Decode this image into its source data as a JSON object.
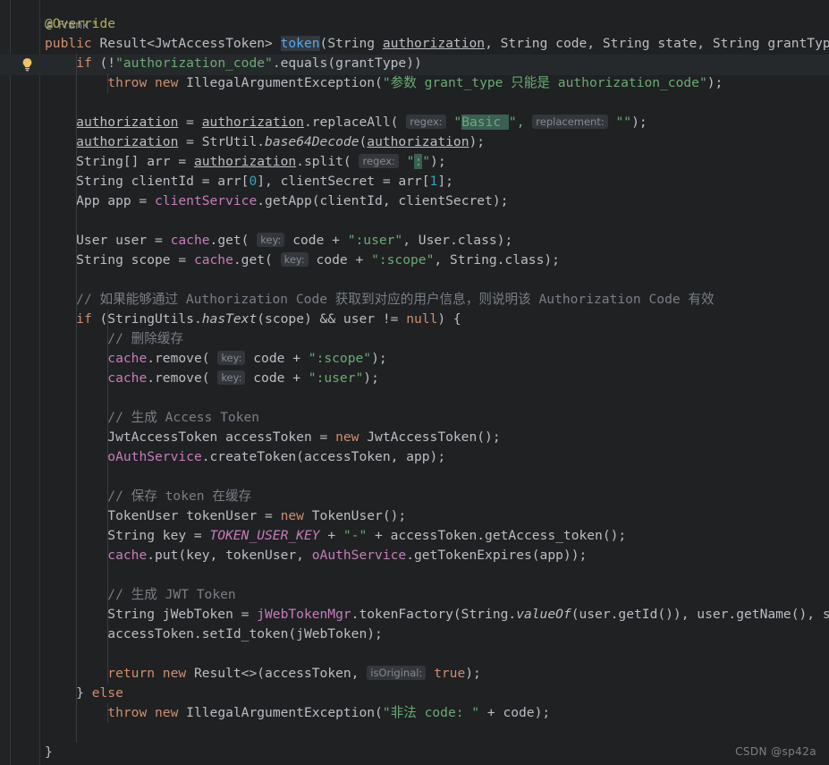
{
  "editor": {
    "theme": "dark",
    "background": "#1f2123",
    "current_line_background": "#26292c",
    "watermark": "CSDN @sp42a"
  },
  "vcs_annotation": {
    "icon": "person-icon",
    "author": "Frank",
    "modified_marker": "*"
  },
  "gutter": {
    "intention_icon": "lightbulb-icon"
  },
  "colors": {
    "keyword": "#cf8e6d",
    "string": "#6aab73",
    "number": "#2aacb8",
    "comment": "#7a7e85",
    "annotation": "#b3ae60",
    "field": "#c77dbb",
    "method_declaration": "#56a8f5",
    "default_text": "#bcbec4",
    "inlay_hint_bg": "#33363b",
    "selection_highlight": "#3a5f53"
  },
  "code": {
    "language": "java",
    "lines": [
      {
        "tokens": [
          {
            "t": "@Override",
            "c": "anno"
          }
        ]
      },
      {
        "tokens": [
          {
            "t": "public ",
            "c": "kw"
          },
          {
            "t": "Result<JwtAccessToken> ",
            "c": "type"
          },
          {
            "t": "token",
            "c": "method-d hl-ident"
          },
          {
            "t": "(String ",
            "c": "ident"
          },
          {
            "t": "authorization",
            "c": "param-u"
          },
          {
            "t": ", String code, String state, String grantType) {",
            "c": "ident"
          }
        ]
      },
      {
        "tokens": [
          {
            "t": "    ",
            "c": "ident"
          },
          {
            "t": "if",
            "c": "kw"
          },
          {
            "t": " (!",
            "c": "ident"
          },
          {
            "t": "\"authorization_code\"",
            "c": "str"
          },
          {
            "t": ".equals(grantType))",
            "c": "ident"
          }
        ]
      },
      {
        "tokens": [
          {
            "t": "        ",
            "c": "ident"
          },
          {
            "t": "throw new ",
            "c": "kw"
          },
          {
            "t": "IllegalArgumentException(",
            "c": "ident"
          },
          {
            "t": "\"参数 grant_type 只能是 authorization_code\"",
            "c": "str"
          },
          {
            "t": ");",
            "c": "ident"
          }
        ]
      },
      {
        "tokens": []
      },
      {
        "tokens": [
          {
            "t": "    ",
            "c": "ident"
          },
          {
            "t": "authorization",
            "c": "param-u"
          },
          {
            "t": " = ",
            "c": "ident"
          },
          {
            "t": "authorization",
            "c": "param-u"
          },
          {
            "t": ".replaceAll( ",
            "c": "ident"
          },
          {
            "t": "regex:",
            "c": "hint"
          },
          {
            "t": " \"",
            "c": "str"
          },
          {
            "t": "Basic ",
            "c": "str hl-sel"
          },
          {
            "t": "\", ",
            "c": "str"
          },
          {
            "t": "replacement:",
            "c": "hint"
          },
          {
            "t": " \"\"",
            "c": "str"
          },
          {
            "t": ");",
            "c": "ident"
          }
        ]
      },
      {
        "tokens": [
          {
            "t": "    ",
            "c": "ident"
          },
          {
            "t": "authorization",
            "c": "param-u"
          },
          {
            "t": " = StrUtil.",
            "c": "ident"
          },
          {
            "t": "base64Decode",
            "c": "static-it"
          },
          {
            "t": "(",
            "c": "ident"
          },
          {
            "t": "authorization",
            "c": "param-u"
          },
          {
            "t": ");",
            "c": "ident"
          }
        ]
      },
      {
        "tokens": [
          {
            "t": "    String[] arr = ",
            "c": "ident"
          },
          {
            "t": "authorization",
            "c": "param-u"
          },
          {
            "t": ".split( ",
            "c": "ident"
          },
          {
            "t": "regex:",
            "c": "hint"
          },
          {
            "t": " \"",
            "c": "str"
          },
          {
            "t": ":",
            "c": "str hl-sel"
          },
          {
            "t": "\"",
            "c": "str"
          },
          {
            "t": ");",
            "c": "ident"
          }
        ]
      },
      {
        "tokens": [
          {
            "t": "    String clientId = arr[",
            "c": "ident"
          },
          {
            "t": "0",
            "c": "num"
          },
          {
            "t": "], clientSecret = arr[",
            "c": "ident"
          },
          {
            "t": "1",
            "c": "num"
          },
          {
            "t": "];",
            "c": "ident"
          }
        ]
      },
      {
        "tokens": [
          {
            "t": "    App app = ",
            "c": "ident"
          },
          {
            "t": "clientService",
            "c": "field"
          },
          {
            "t": ".getApp(clientId, clientSecret);",
            "c": "ident"
          }
        ]
      },
      {
        "tokens": []
      },
      {
        "tokens": [
          {
            "t": "    User user = ",
            "c": "ident"
          },
          {
            "t": "cache",
            "c": "field"
          },
          {
            "t": ".get( ",
            "c": "ident"
          },
          {
            "t": "key:",
            "c": "hint"
          },
          {
            "t": " code + ",
            "c": "ident"
          },
          {
            "t": "\":user\"",
            "c": "str"
          },
          {
            "t": ", User.class);",
            "c": "ident"
          }
        ]
      },
      {
        "tokens": [
          {
            "t": "    String scope = ",
            "c": "ident"
          },
          {
            "t": "cache",
            "c": "field"
          },
          {
            "t": ".get( ",
            "c": "ident"
          },
          {
            "t": "key:",
            "c": "hint"
          },
          {
            "t": " code + ",
            "c": "ident"
          },
          {
            "t": "\":scope\"",
            "c": "str"
          },
          {
            "t": ", String.class);",
            "c": "ident"
          }
        ]
      },
      {
        "tokens": []
      },
      {
        "tokens": [
          {
            "t": "    ",
            "c": "ident"
          },
          {
            "t": "// 如果能够通过 Authorization Code 获取到对应的用户信息，则说明该 Authorization Code 有效",
            "c": "comment"
          }
        ]
      },
      {
        "tokens": [
          {
            "t": "    ",
            "c": "ident"
          },
          {
            "t": "if",
            "c": "kw"
          },
          {
            "t": " (StringUtils.",
            "c": "ident"
          },
          {
            "t": "hasText",
            "c": "static-it"
          },
          {
            "t": "(scope) && user != ",
            "c": "ident"
          },
          {
            "t": "null",
            "c": "kw"
          },
          {
            "t": ") {",
            "c": "ident"
          }
        ]
      },
      {
        "tokens": [
          {
            "t": "        ",
            "c": "ident"
          },
          {
            "t": "// 删除缓存",
            "c": "comment"
          }
        ]
      },
      {
        "tokens": [
          {
            "t": "        ",
            "c": "ident"
          },
          {
            "t": "cache",
            "c": "field"
          },
          {
            "t": ".remove( ",
            "c": "ident"
          },
          {
            "t": "key:",
            "c": "hint"
          },
          {
            "t": " code + ",
            "c": "ident"
          },
          {
            "t": "\":scope\"",
            "c": "str"
          },
          {
            "t": ");",
            "c": "ident"
          }
        ]
      },
      {
        "tokens": [
          {
            "t": "        ",
            "c": "ident"
          },
          {
            "t": "cache",
            "c": "field"
          },
          {
            "t": ".remove( ",
            "c": "ident"
          },
          {
            "t": "key:",
            "c": "hint"
          },
          {
            "t": " code + ",
            "c": "ident"
          },
          {
            "t": "\":user\"",
            "c": "str"
          },
          {
            "t": ");",
            "c": "ident"
          }
        ]
      },
      {
        "tokens": []
      },
      {
        "tokens": [
          {
            "t": "        ",
            "c": "ident"
          },
          {
            "t": "// 生成 Access Token",
            "c": "comment"
          }
        ]
      },
      {
        "tokens": [
          {
            "t": "        JwtAccessToken accessToken = ",
            "c": "ident"
          },
          {
            "t": "new ",
            "c": "kw"
          },
          {
            "t": "JwtAccessToken();",
            "c": "ident"
          }
        ]
      },
      {
        "tokens": [
          {
            "t": "        ",
            "c": "ident"
          },
          {
            "t": "oAuthService",
            "c": "field"
          },
          {
            "t": ".createToken(accessToken, app);",
            "c": "ident"
          }
        ]
      },
      {
        "tokens": []
      },
      {
        "tokens": [
          {
            "t": "        ",
            "c": "ident"
          },
          {
            "t": "// 保存 token 在缓存",
            "c": "comment"
          }
        ]
      },
      {
        "tokens": [
          {
            "t": "        TokenUser tokenUser = ",
            "c": "ident"
          },
          {
            "t": "new ",
            "c": "kw"
          },
          {
            "t": "TokenUser();",
            "c": "ident"
          }
        ]
      },
      {
        "tokens": [
          {
            "t": "        String key = ",
            "c": "ident"
          },
          {
            "t": "TOKEN_USER_KEY",
            "c": "const-it"
          },
          {
            "t": " + ",
            "c": "ident"
          },
          {
            "t": "\"-\"",
            "c": "str"
          },
          {
            "t": " + accessToken.getAccess_token();",
            "c": "ident"
          }
        ]
      },
      {
        "tokens": [
          {
            "t": "        ",
            "c": "ident"
          },
          {
            "t": "cache",
            "c": "field"
          },
          {
            "t": ".put(key, tokenUser, ",
            "c": "ident"
          },
          {
            "t": "oAuthService",
            "c": "field"
          },
          {
            "t": ".getTokenExpires(app));",
            "c": "ident"
          }
        ]
      },
      {
        "tokens": []
      },
      {
        "tokens": [
          {
            "t": "        ",
            "c": "ident"
          },
          {
            "t": "// 生成 JWT Token",
            "c": "comment"
          }
        ]
      },
      {
        "tokens": [
          {
            "t": "        String jWebToken = ",
            "c": "ident"
          },
          {
            "t": "jWebTokenMgr",
            "c": "field"
          },
          {
            "t": ".tokenFactory(String.",
            "c": "ident"
          },
          {
            "t": "valueOf",
            "c": "static-it"
          },
          {
            "t": "(user.getId()), user.getName(), scope, Util",
            "c": "ident"
          }
        ]
      },
      {
        "tokens": [
          {
            "t": "        accessToken.setId_token(jWebToken);",
            "c": "ident"
          }
        ]
      },
      {
        "tokens": []
      },
      {
        "tokens": [
          {
            "t": "        ",
            "c": "ident"
          },
          {
            "t": "return new ",
            "c": "kw"
          },
          {
            "t": "Result<>(accessToken, ",
            "c": "ident"
          },
          {
            "t": "isOriginal:",
            "c": "hint"
          },
          {
            "t": " ",
            "c": "ident"
          },
          {
            "t": "true",
            "c": "kw"
          },
          {
            "t": ");",
            "c": "ident"
          }
        ]
      },
      {
        "tokens": [
          {
            "t": "    } ",
            "c": "ident"
          },
          {
            "t": "else",
            "c": "kw"
          }
        ]
      },
      {
        "tokens": [
          {
            "t": "        ",
            "c": "ident"
          },
          {
            "t": "throw new ",
            "c": "kw"
          },
          {
            "t": "IllegalArgumentException(",
            "c": "ident"
          },
          {
            "t": "\"非法 code: \"",
            "c": "str"
          },
          {
            "t": " + code);",
            "c": "ident"
          }
        ]
      },
      {
        "tokens": []
      },
      {
        "tokens": [
          {
            "t": "}",
            "c": "ident"
          }
        ]
      }
    ]
  }
}
